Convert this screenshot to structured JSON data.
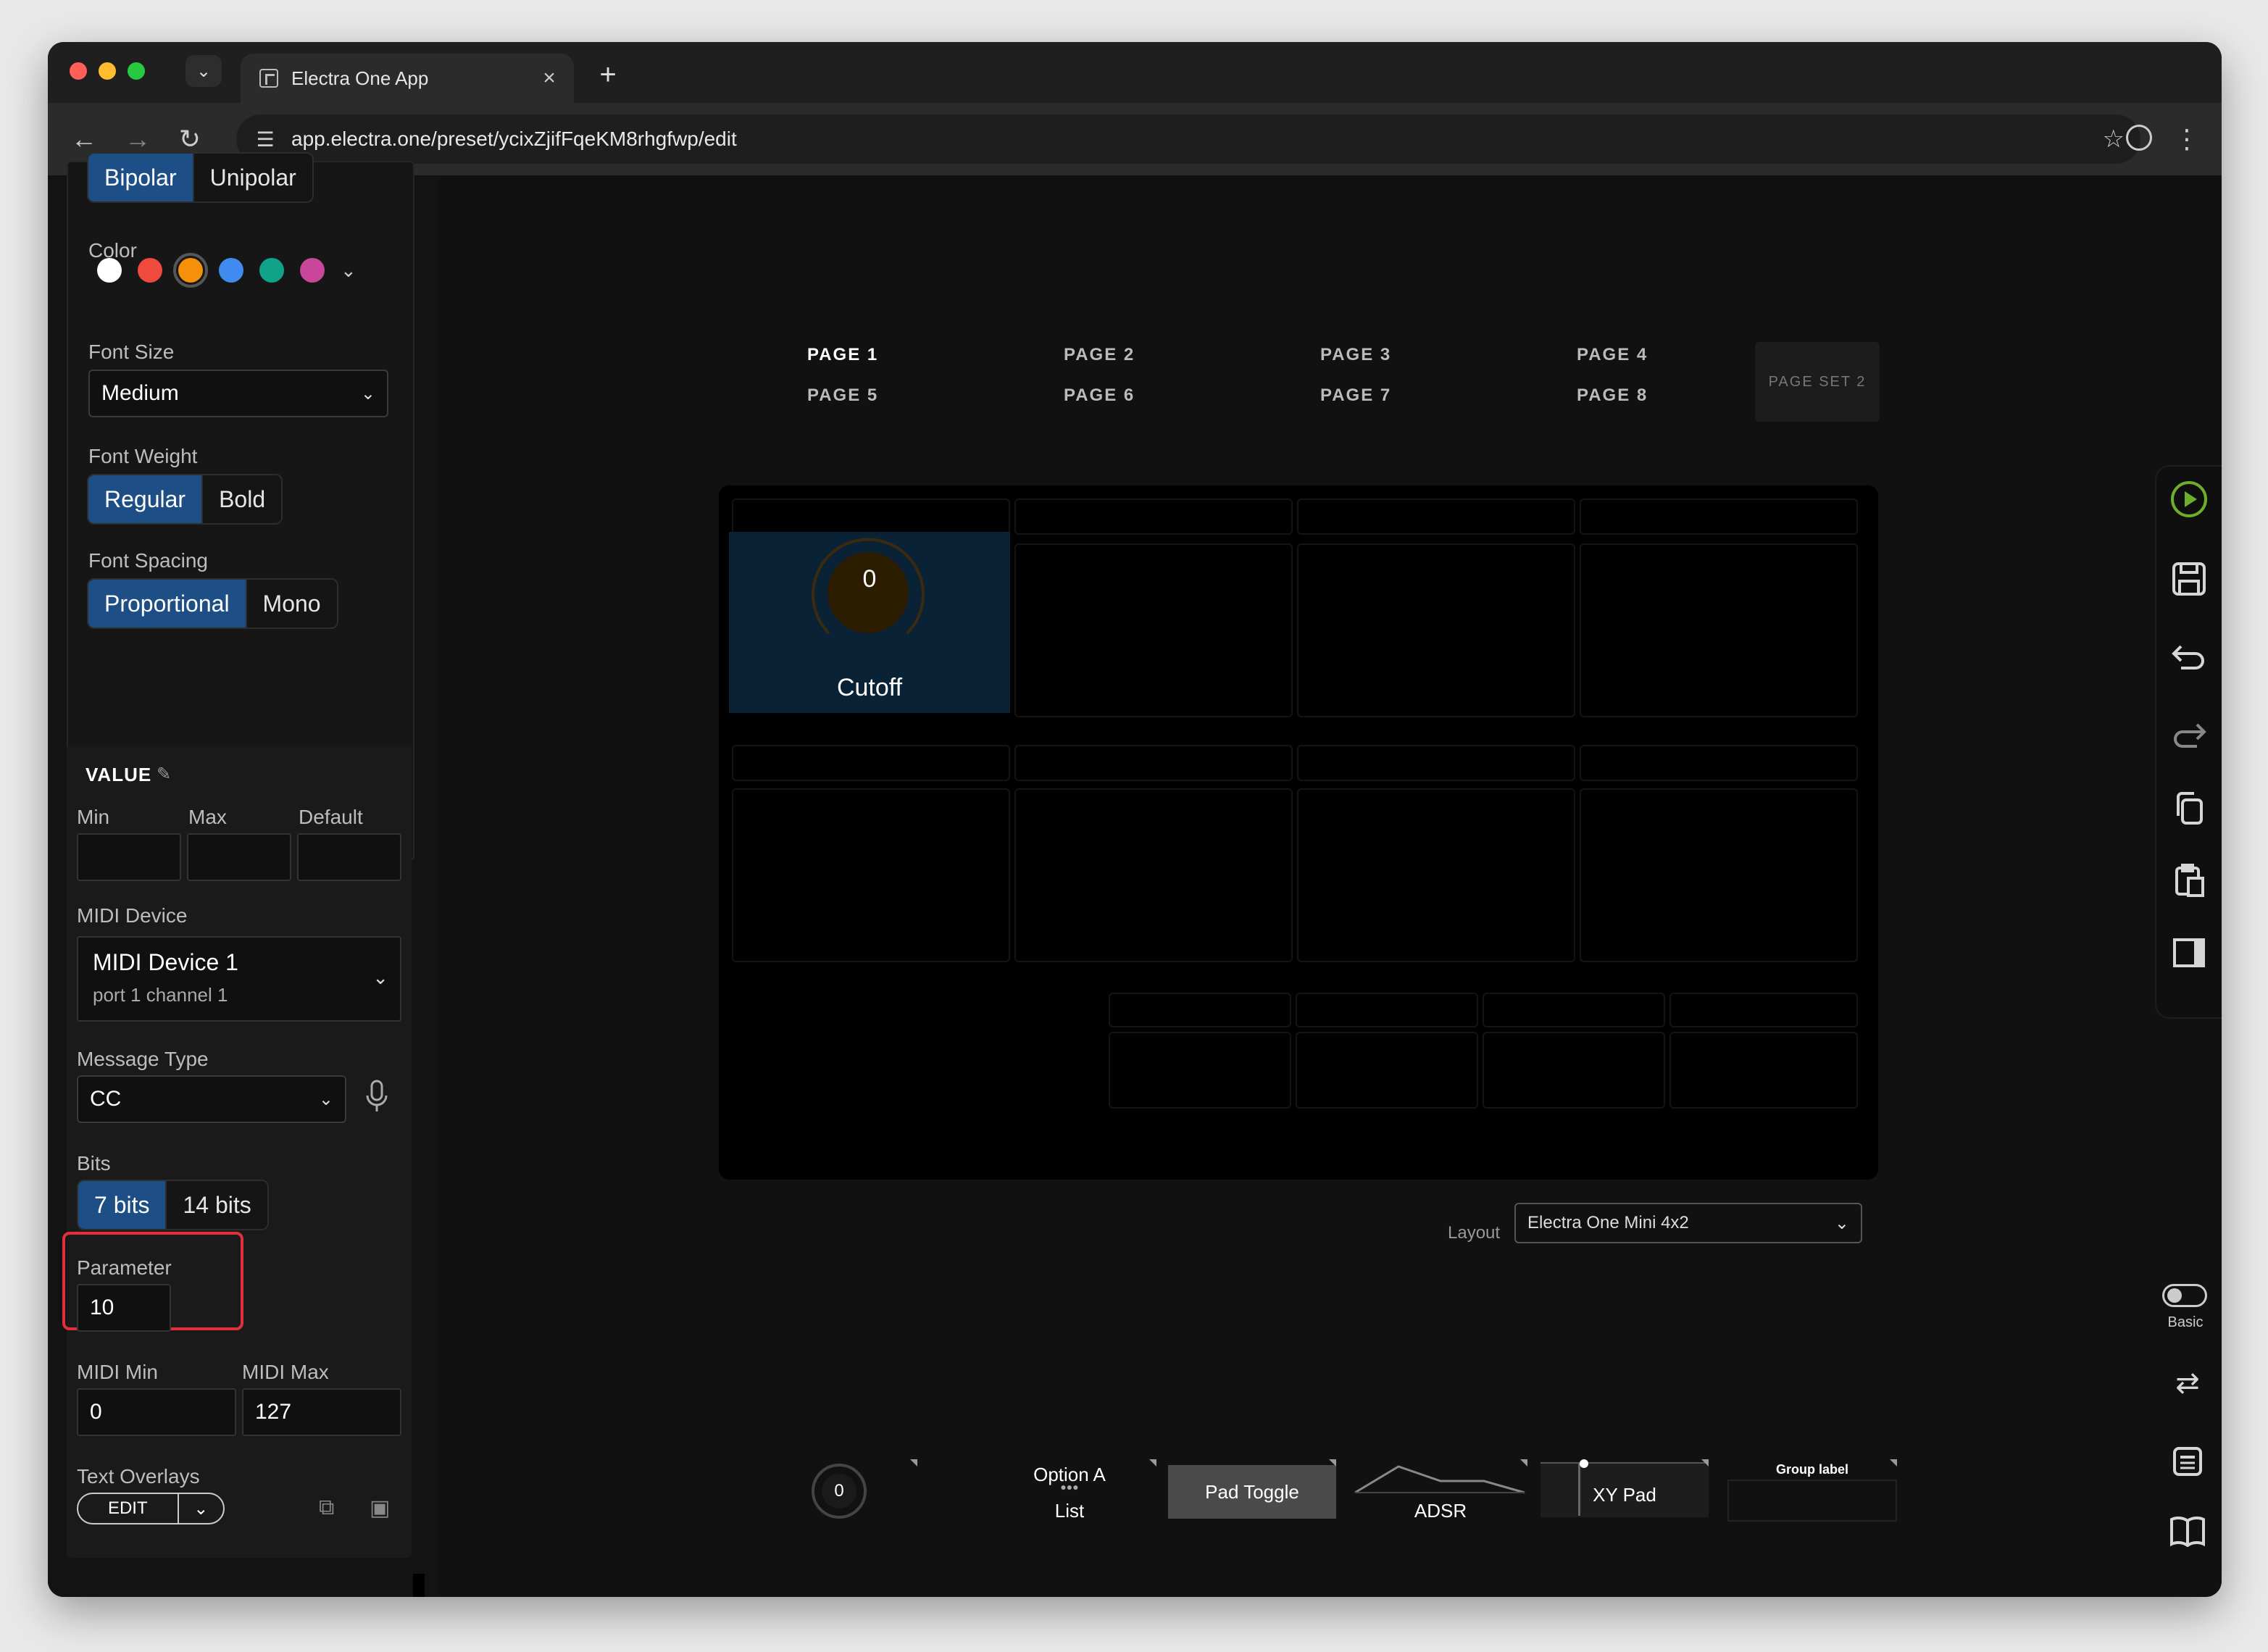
{
  "browser": {
    "tab_title": "Electra One App",
    "url": "app.electra.one/preset/ycixZjifFqeKM8rhgfwp/edit"
  },
  "left_panel": {
    "mode_options": [
      "Bipolar",
      "Unipolar"
    ],
    "mode_selected": "Bipolar",
    "color_label": "Color",
    "colors": [
      "#ffffff",
      "#f04a3e",
      "#f5900a",
      "#3f8bf0",
      "#10a38a",
      "#c9479a"
    ],
    "color_selected": "#f5900a",
    "font_size_label": "Font Size",
    "font_size_value": "Medium",
    "font_weight_label": "Font Weight",
    "font_weight_options": [
      "Regular",
      "Bold"
    ],
    "font_weight_selected": "Regular",
    "font_spacing_label": "Font Spacing",
    "font_spacing_options": [
      "Proportional",
      "Mono"
    ],
    "font_spacing_selected": "Proportional",
    "value": {
      "title": "VALUE",
      "min_label": "Min",
      "max_label": "Max",
      "default_label": "Default",
      "min_value": "",
      "max_value": "",
      "default_value": "",
      "midi_device_label": "MIDI Device",
      "midi_device_name": "MIDI Device 1",
      "midi_device_sub": "port 1 channel 1",
      "message_type_label": "Message Type",
      "message_type_value": "CC",
      "bits_label": "Bits",
      "bits_options": [
        "7 bits",
        "14 bits"
      ],
      "bits_selected": "7 bits",
      "parameter_label": "Parameter",
      "parameter_value": "10",
      "midi_min_label": "MIDI Min",
      "midi_max_label": "MIDI Max",
      "midi_min_value": "0",
      "midi_max_value": "127",
      "text_overlays_label": "Text Overlays",
      "edit_label": "EDIT"
    }
  },
  "pages": {
    "row1": [
      "PAGE 1",
      "PAGE 2",
      "PAGE 3",
      "PAGE 4"
    ],
    "row2": [
      "PAGE 5",
      "PAGE 6",
      "PAGE 7",
      "PAGE 8"
    ],
    "active": "PAGE 1",
    "page_set": "PAGE SET 2"
  },
  "device": {
    "control_value": "0",
    "control_name": "Cutoff",
    "accent": "#f5900a"
  },
  "layout": {
    "label": "Layout",
    "value": "Electra One Mini 4x2"
  },
  "palette": {
    "knob_value": "0",
    "option_a": "Option A",
    "list": "List",
    "pad_toggle": "Pad Toggle",
    "adsr": "ADSR",
    "xy_pad": "XY Pad",
    "group_label": "Group label"
  },
  "right_rail": {
    "basic_label": "Basic"
  }
}
